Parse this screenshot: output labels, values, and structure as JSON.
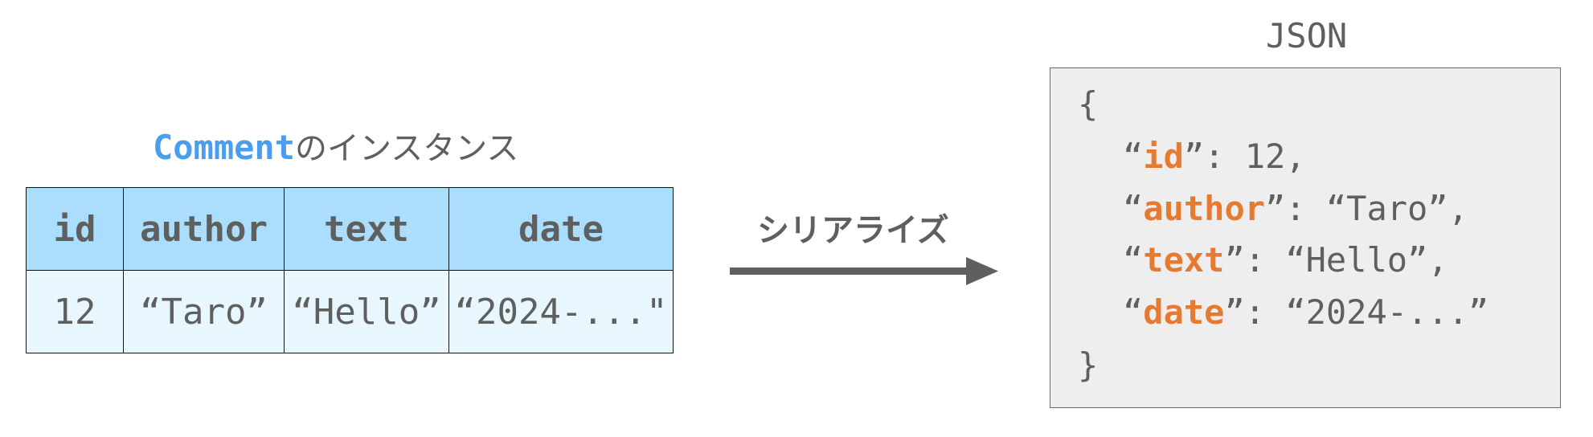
{
  "instance": {
    "class_name": "Comment",
    "caption_suffix": "のインスタンス",
    "columns": [
      "id",
      "author",
      "text",
      "date"
    ],
    "values": [
      "12",
      "“Taro”",
      "“Hello”",
      "“2024-...\""
    ]
  },
  "arrow": {
    "label": "シリアライズ"
  },
  "json": {
    "title": "JSON",
    "open_brace": "{",
    "close_brace": "}",
    "entries": [
      {
        "open_quote": "“",
        "key": "id",
        "sep": "”: ",
        "value": "12,"
      },
      {
        "open_quote": "“",
        "key": "author",
        "sep": "”: ",
        "value": "“Taro”,"
      },
      {
        "open_quote": "“",
        "key": "text",
        "sep": "”: ",
        "value": "“Hello”,"
      },
      {
        "open_quote": "“",
        "key": "date",
        "sep": "”: ",
        "value": "“2024-...”"
      }
    ]
  },
  "colors": {
    "class_name": "#4a9ef0",
    "header_bg": "#aadefc",
    "row_bg": "#e8f6fd",
    "json_key": "#e67a30",
    "json_bg": "#eeeeee",
    "text": "#5f5f5f"
  }
}
